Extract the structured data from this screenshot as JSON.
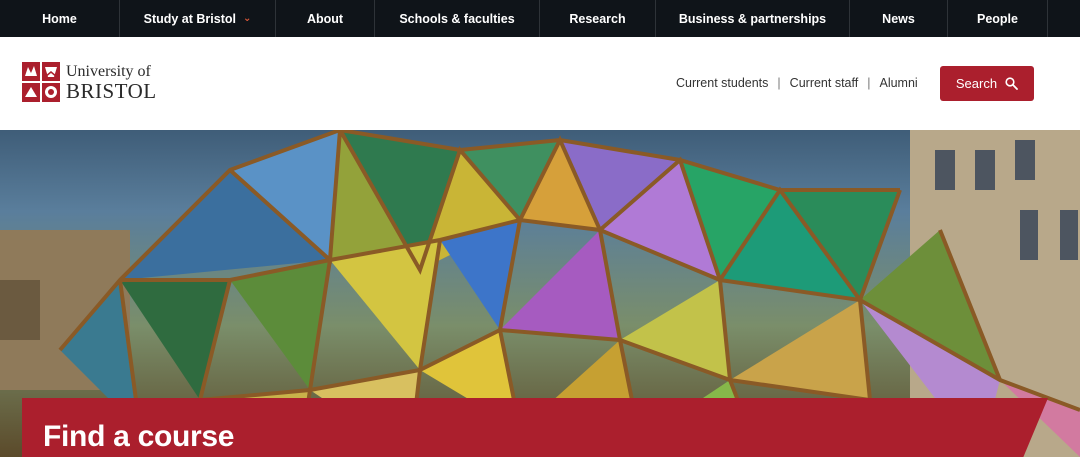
{
  "topnav": {
    "items": [
      {
        "label": "Home"
      },
      {
        "label": "Study at Bristol",
        "has_dropdown": true
      },
      {
        "label": "About"
      },
      {
        "label": "Schools & faculties"
      },
      {
        "label": "Research"
      },
      {
        "label": "Business & partnerships"
      },
      {
        "label": "News"
      },
      {
        "label": "People"
      }
    ],
    "dropdown_icon": "chevron-down-icon"
  },
  "header": {
    "logo": {
      "line1": "University of",
      "line2": "BRISTOL"
    },
    "utility_links": [
      "Current students",
      "Current staff",
      "Alumni"
    ],
    "separator": "|",
    "search_label": "Search",
    "search_icon": "search-icon"
  },
  "hero": {
    "heading": "Find a course"
  },
  "colors": {
    "nav_bg": "#0f1419",
    "brand_red": "#ab1f2d",
    "dropdown_accent": "#e05a3a"
  }
}
